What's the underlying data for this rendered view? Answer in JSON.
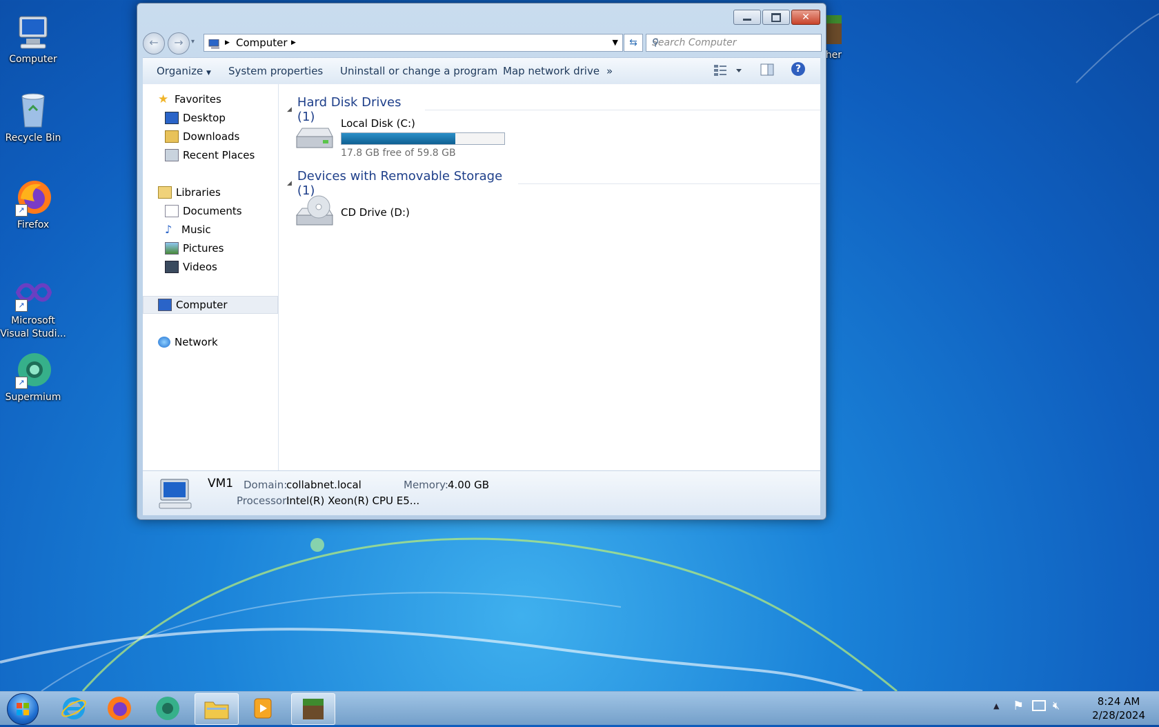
{
  "desktop": {
    "icons": [
      {
        "label": "Computer"
      },
      {
        "label": "Recycle Bin"
      },
      {
        "label": "Firefox"
      },
      {
        "label": "Microsoft Visual Studi..."
      },
      {
        "label": "Supermium"
      }
    ],
    "partial_icon_label": "cher"
  },
  "window": {
    "address": {
      "crumb": "Computer"
    },
    "search": {
      "placeholder": "Search Computer"
    },
    "toolbar": {
      "organize": "Organize",
      "system_properties": "System properties",
      "uninstall": "Uninstall or change a program",
      "map_drive": "Map network drive",
      "more": "»"
    },
    "nav": {
      "favorites": "Favorites",
      "desktop": "Desktop",
      "downloads": "Downloads",
      "recent": "Recent Places",
      "libraries": "Libraries",
      "documents": "Documents",
      "music": "Music",
      "pictures": "Pictures",
      "videos": "Videos",
      "computer": "Computer",
      "network": "Network"
    },
    "groups": {
      "hdd": "Hard Disk Drives (1)",
      "removable": "Devices with Removable Storage (1)"
    },
    "drives": {
      "c_name": "Local Disk (C:)",
      "c_free": "17.8 GB free of 59.8 GB",
      "c_used_fraction": 0.7,
      "d_name": "CD Drive (D:)"
    },
    "details": {
      "name": "VM1",
      "domain_label": "Domain:",
      "domain_value": "collabnet.local",
      "memory_label": "Memory:",
      "memory_value": "4.00 GB",
      "processor_label": "Processor:",
      "processor_value": "Intel(R) Xeon(R) CPU E5..."
    }
  },
  "taskbar": {
    "time": "8:24 AM",
    "date": "2/28/2024"
  }
}
